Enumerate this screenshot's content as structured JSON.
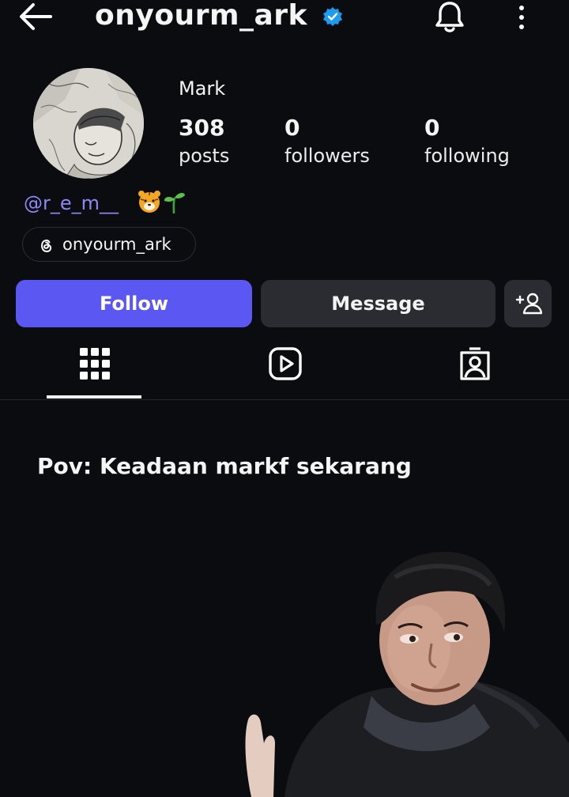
{
  "header": {
    "username": "onyourm_ark",
    "verified": true,
    "accent_color": "#1d9bf0"
  },
  "profile": {
    "display_name": "Mark",
    "stats": [
      {
        "value": "308",
        "label": "posts"
      },
      {
        "value": "0",
        "label": "followers"
      },
      {
        "value": "0",
        "label": "following"
      }
    ],
    "bio_mention": "@r_e_m__",
    "bio_emojis": [
      "tiger-face",
      "seedling"
    ],
    "threads_handle": "onyourm_ark"
  },
  "actions": {
    "follow_label": "Follow",
    "message_label": "Message",
    "follow_color": "#5b57f3"
  },
  "tabs": [
    {
      "name": "posts-grid",
      "icon": "grid-icon",
      "active": true
    },
    {
      "name": "reels",
      "icon": "reels-icon",
      "active": false
    },
    {
      "name": "tagged",
      "icon": "tagged-icon",
      "active": false
    }
  ],
  "overlay": {
    "caption": "Pov: Keadaan markf sekarang"
  }
}
